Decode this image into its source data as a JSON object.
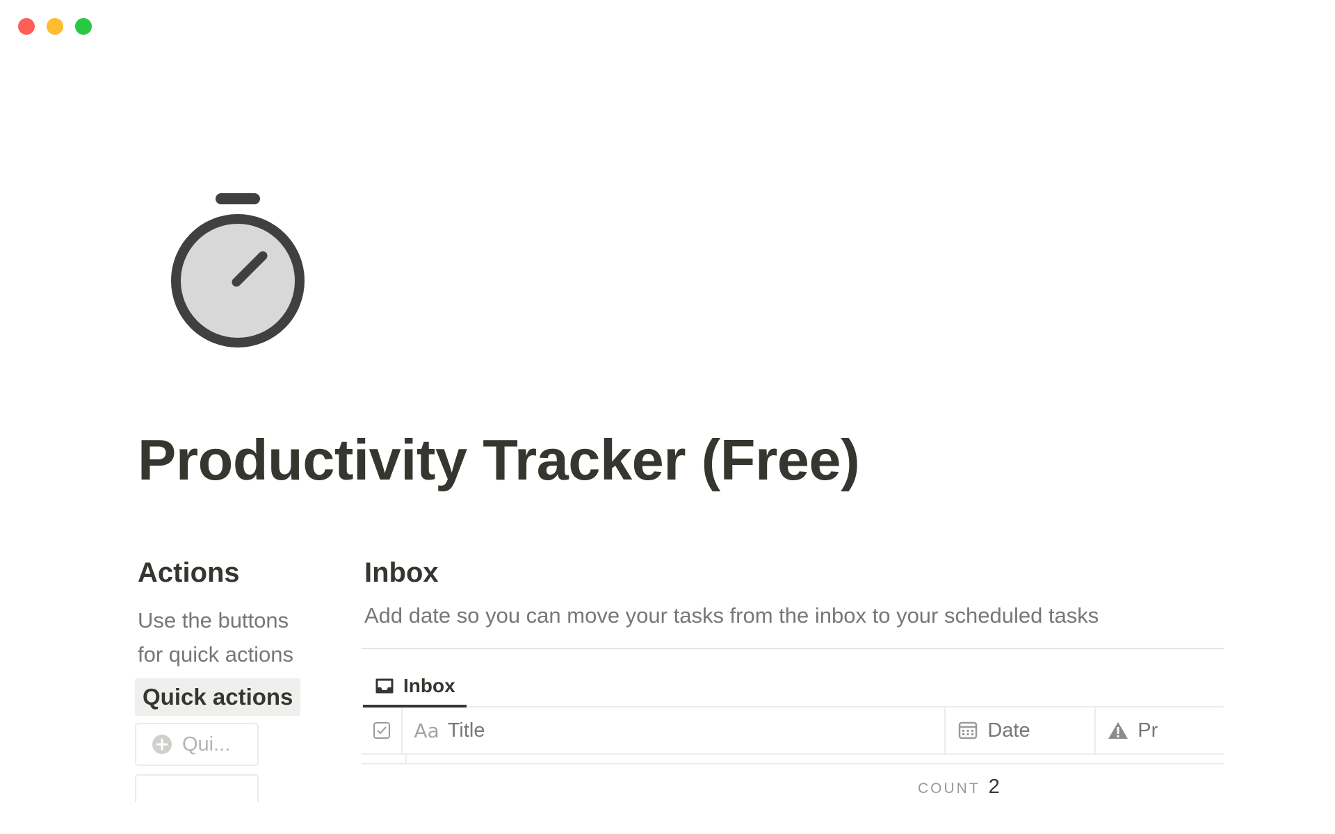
{
  "window": {
    "controls": [
      "close",
      "minimize",
      "maximize"
    ]
  },
  "page": {
    "icon": "stopwatch-icon",
    "title": "Productivity Tracker (Free)"
  },
  "actions": {
    "heading": "Actions",
    "description": "Use the buttons for quick actions",
    "quick_actions_label": "Quick actions",
    "quick_button_label": "Qui..."
  },
  "inbox": {
    "heading": "Inbox",
    "description": "Add date so you can move your tasks from the inbox to your scheduled tasks",
    "view_tab_label": "Inbox",
    "columns": [
      {
        "icon": "checkbox-icon",
        "label": ""
      },
      {
        "icon": "text-aa-icon",
        "icon_text": "Aa",
        "label": "Title"
      },
      {
        "icon": "calendar-icon",
        "label": "Date"
      },
      {
        "icon": "warning-triangle-icon",
        "label": "Pr"
      }
    ],
    "count_label": "COUNT",
    "count_value": "2"
  },
  "colors": {
    "text": "#37352f",
    "muted": "#787774",
    "traffic_red": "#ff5f57",
    "traffic_yellow": "#febc2e",
    "traffic_green": "#28c840"
  }
}
